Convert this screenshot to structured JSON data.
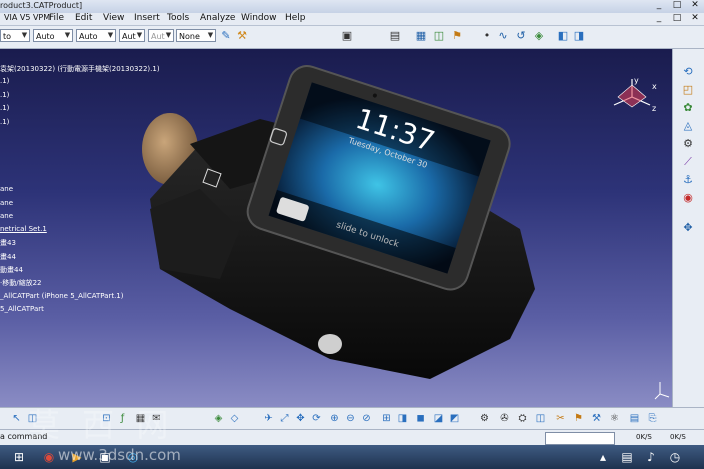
{
  "window": {
    "title": "roduct3.CATProduct]",
    "controls": [
      "_",
      "□",
      "✕"
    ]
  },
  "menu": {
    "logo": "VIA V5 VPM",
    "items": [
      "File",
      "Edit",
      "View",
      "Insert",
      "Tools",
      "Analyze",
      "Window",
      "Help"
    ]
  },
  "toolbar": {
    "dropdowns": [
      {
        "value": "to"
      },
      {
        "value": "Auto"
      },
      {
        "value": "Auto"
      },
      {
        "value": "Aut"
      },
      {
        "value": "Aut"
      },
      {
        "value": "None"
      }
    ]
  },
  "tree": {
    "nodes": [
      "袁架(20130322) (行動電源手機架(20130322).1)",
      ".1)",
      ".1)",
      ".1)",
      ".1)",
      "ane",
      "ane",
      "ane",
      "netrical Set.1",
      "畫43",
      "畫44",
      "動畫44",
      "·移動/縮放22",
      "_AllCATPart (iPhone 5_AllCATPart.1)",
      "5_AllCATPart"
    ]
  },
  "viewport": {
    "phone_time": "11:37",
    "phone_date": "Tuesday, October 30",
    "unlock_text": "slide to unlock",
    "axis_x": "x",
    "axis_y": "y",
    "axis_z": "z"
  },
  "statusbar": {
    "command": "a command",
    "speed1": "0K/S",
    "speed2": "0K/S"
  },
  "watermark": {
    "chars": "莫 西 网",
    "url": "www.3dsdn.com"
  },
  "colors": {
    "viewport_top": "#1a1c4e",
    "viewport_bottom": "#8a8cc4",
    "toolbar_bg": "#e8edf4",
    "taskbar": "#2a4466"
  }
}
